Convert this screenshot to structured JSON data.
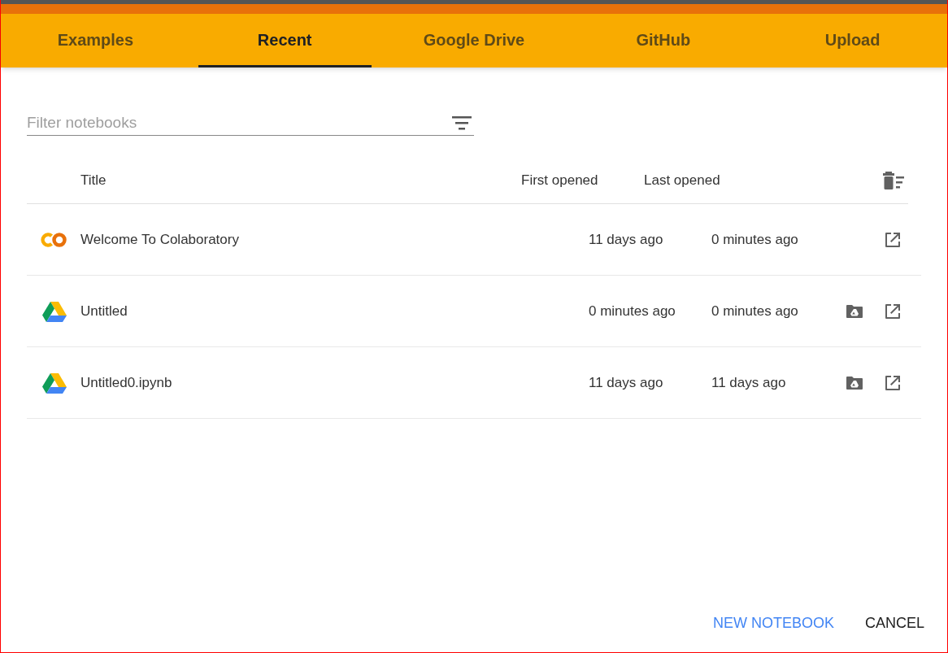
{
  "tabs": [
    {
      "label": "Examples",
      "selected": false
    },
    {
      "label": "Recent",
      "selected": true
    },
    {
      "label": "Google Drive",
      "selected": false
    },
    {
      "label": "GitHub",
      "selected": false
    },
    {
      "label": "Upload",
      "selected": false
    }
  ],
  "filter": {
    "placeholder": "Filter notebooks"
  },
  "table": {
    "columns": [
      "Title",
      "First opened",
      "Last opened"
    ],
    "rows": [
      {
        "kind": "colab",
        "title": "Welcome To Colaboratory",
        "first_opened": "11 days ago",
        "last_opened": "0 minutes ago"
      },
      {
        "kind": "drive",
        "title": "Untitled",
        "first_opened": "0 minutes ago",
        "last_opened": "0 minutes ago"
      },
      {
        "kind": "drive",
        "title": "Untitled0.ipynb",
        "first_opened": "11 days ago",
        "last_opened": "11 days ago"
      }
    ]
  },
  "buttons": [
    {
      "kind": "primary",
      "label": "NEW NOTEBOOK"
    },
    {
      "kind": "plain",
      "label": "CANCEL"
    }
  ]
}
